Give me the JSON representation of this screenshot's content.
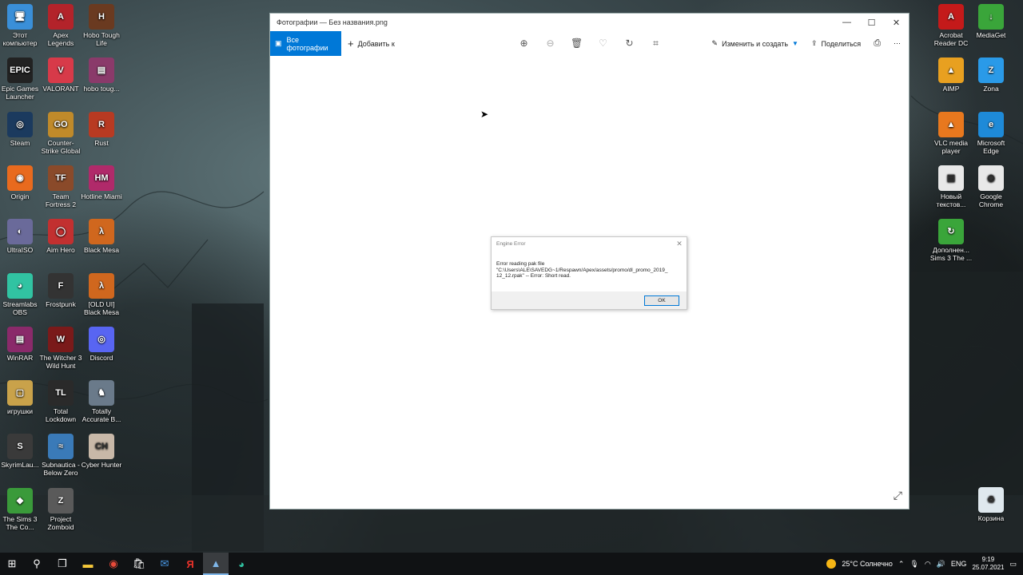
{
  "desktop": {
    "left_icons": [
      {
        "label": "Этот компьютер",
        "icon": "computer-icon",
        "color": "#3a8fd8",
        "glyph": "🖥"
      },
      {
        "label": "Apex Legends",
        "icon": "apex-icon",
        "color": "#b3232a",
        "glyph": "A"
      },
      {
        "label": "Hobo Tough Life",
        "icon": "hobo-icon",
        "color": "#6a3a20",
        "glyph": "H"
      },
      {
        "label": "Epic Games Launcher",
        "icon": "epic-icon",
        "color": "#222222",
        "glyph": "EPIC"
      },
      {
        "label": "VALORANT",
        "icon": "valorant-icon",
        "color": "#d73a49",
        "glyph": "V"
      },
      {
        "label": "hobo toug...",
        "icon": "winrar-archive-icon",
        "color": "#8a3a6a",
        "glyph": "▤"
      },
      {
        "label": "Steam",
        "icon": "steam-icon",
        "color": "#1b3a5e",
        "glyph": "◎"
      },
      {
        "label": "Counter-Strike Global Offe...",
        "icon": "csgo-icon",
        "color": "#c08a2a",
        "glyph": "GO"
      },
      {
        "label": "Rust",
        "icon": "rust-icon",
        "color": "#b83a22",
        "glyph": "R"
      },
      {
        "label": "Origin",
        "icon": "origin-icon",
        "color": "#e86a1e",
        "glyph": "◉"
      },
      {
        "label": "Team Fortress 2",
        "icon": "tf2-icon",
        "color": "#8a4a2a",
        "glyph": "TF"
      },
      {
        "label": "Hotline Miami",
        "icon": "hotline-miami-icon",
        "color": "#b02a6a",
        "glyph": "HM"
      },
      {
        "label": "UltraISO",
        "icon": "ultraiso-icon",
        "color": "#6a6a9a",
        "glyph": "◐"
      },
      {
        "label": "Aim Hero",
        "icon": "aimhero-icon",
        "color": "#c23030",
        "glyph": "◯"
      },
      {
        "label": "Black Mesa",
        "icon": "blackmesa-icon",
        "color": "#d0671e",
        "glyph": "λ"
      },
      {
        "label": "Streamlabs OBS",
        "icon": "streamlabs-icon",
        "color": "#31c3a2",
        "glyph": "◕"
      },
      {
        "label": "Frostpunk",
        "icon": "frostpunk-icon",
        "color": "#333333",
        "glyph": "F"
      },
      {
        "label": "[OLD UI] Black Mesa",
        "icon": "blackmesa-old-icon",
        "color": "#d0671e",
        "glyph": "λ"
      },
      {
        "label": "WinRAR",
        "icon": "winrar-icon",
        "color": "#8a2a6a",
        "glyph": "▤"
      },
      {
        "label": "The Witcher 3 Wild Hunt",
        "icon": "witcher-icon",
        "color": "#7a1a1a",
        "glyph": "W"
      },
      {
        "label": "Discord",
        "icon": "discord-icon",
        "color": "#5865f2",
        "glyph": "◎"
      },
      {
        "label": "игрушки",
        "icon": "folder-icon",
        "color": "#c9a24a",
        "glyph": "▢"
      },
      {
        "label": "Total Lockdown",
        "icon": "total-lockdown-icon",
        "color": "#2a2a2a",
        "glyph": "TL"
      },
      {
        "label": "Totally Accurate B...",
        "icon": "tabs-icon",
        "color": "#6a7a8a",
        "glyph": "♞"
      },
      {
        "label": "SkyrimLau...",
        "icon": "skyrim-icon",
        "color": "#3a3a3a",
        "glyph": "S"
      },
      {
        "label": "Subnautica - Below Zero",
        "icon": "subnautica-icon",
        "color": "#3a7ab8",
        "glyph": "≈"
      },
      {
        "label": "Cyber Hunter",
        "icon": "cyberhunter-icon",
        "color": "#c8b8a8",
        "glyph": "CH"
      },
      {
        "label": "The Sims 3 The Co...",
        "icon": "sims3-icon",
        "color": "#3a9a3a",
        "glyph": "◆"
      },
      {
        "label": "Project Zomboid",
        "icon": "zomboid-icon",
        "color": "#5a5a5a",
        "glyph": "Z"
      }
    ],
    "right_icons": [
      {
        "label": "Acrobat Reader DC",
        "icon": "acrobat-icon",
        "color": "#c41a1a",
        "glyph": "A"
      },
      {
        "label": "MediaGet",
        "icon": "mediaget-icon",
        "color": "#3aa53a",
        "glyph": "↓"
      },
      {
        "label": "AIMP",
        "icon": "aimp-icon",
        "color": "#e8a020",
        "glyph": "▲"
      },
      {
        "label": "Zona",
        "icon": "zona-icon",
        "color": "#2a9ae8",
        "glyph": "Z"
      },
      {
        "label": "VLC media player",
        "icon": "vlc-icon",
        "color": "#e8781e",
        "glyph": "▲"
      },
      {
        "label": "Microsoft Edge",
        "icon": "edge-icon",
        "color": "#1e8ad8",
        "glyph": "e"
      },
      {
        "label": "Новый текстов...",
        "icon": "text-file-icon",
        "color": "#e8e8e8",
        "glyph": "▤"
      },
      {
        "label": "Google Chrome",
        "icon": "chrome-icon",
        "color": "#e8e8e8",
        "glyph": "◉"
      },
      {
        "label": "Дополнен... Sims 3 The ...",
        "icon": "sims3-addon-icon",
        "color": "#3aa53a",
        "glyph": "↻"
      },
      {
        "label": "Корзина",
        "icon": "recycle-bin-icon",
        "color": "#dfe8ee",
        "glyph": "♻"
      }
    ]
  },
  "photos_window": {
    "title": "Фотографии — Без названия.png",
    "all_photos": "Все фотографии",
    "add_to": "Добавить к",
    "edit_create": "Изменить и создать",
    "share": "Поделиться"
  },
  "dialog": {
    "title": "Engine Error",
    "line1": "Error reading pak file",
    "line2": "\"C:\\Users\\ALE\\SAVEDG~1/Respawn/Apex/assets/promo/dl_promo_2019_",
    "line3": "12_12.rpak\" -- Error: Short read.",
    "ok": "OK"
  },
  "taskbar": {
    "weather": "25°C Солнечно",
    "language": "ENG",
    "time": "9:19",
    "date": "25.07.2021"
  },
  "colors": {
    "accent": "#0078d7",
    "taskbar": "#101214"
  }
}
